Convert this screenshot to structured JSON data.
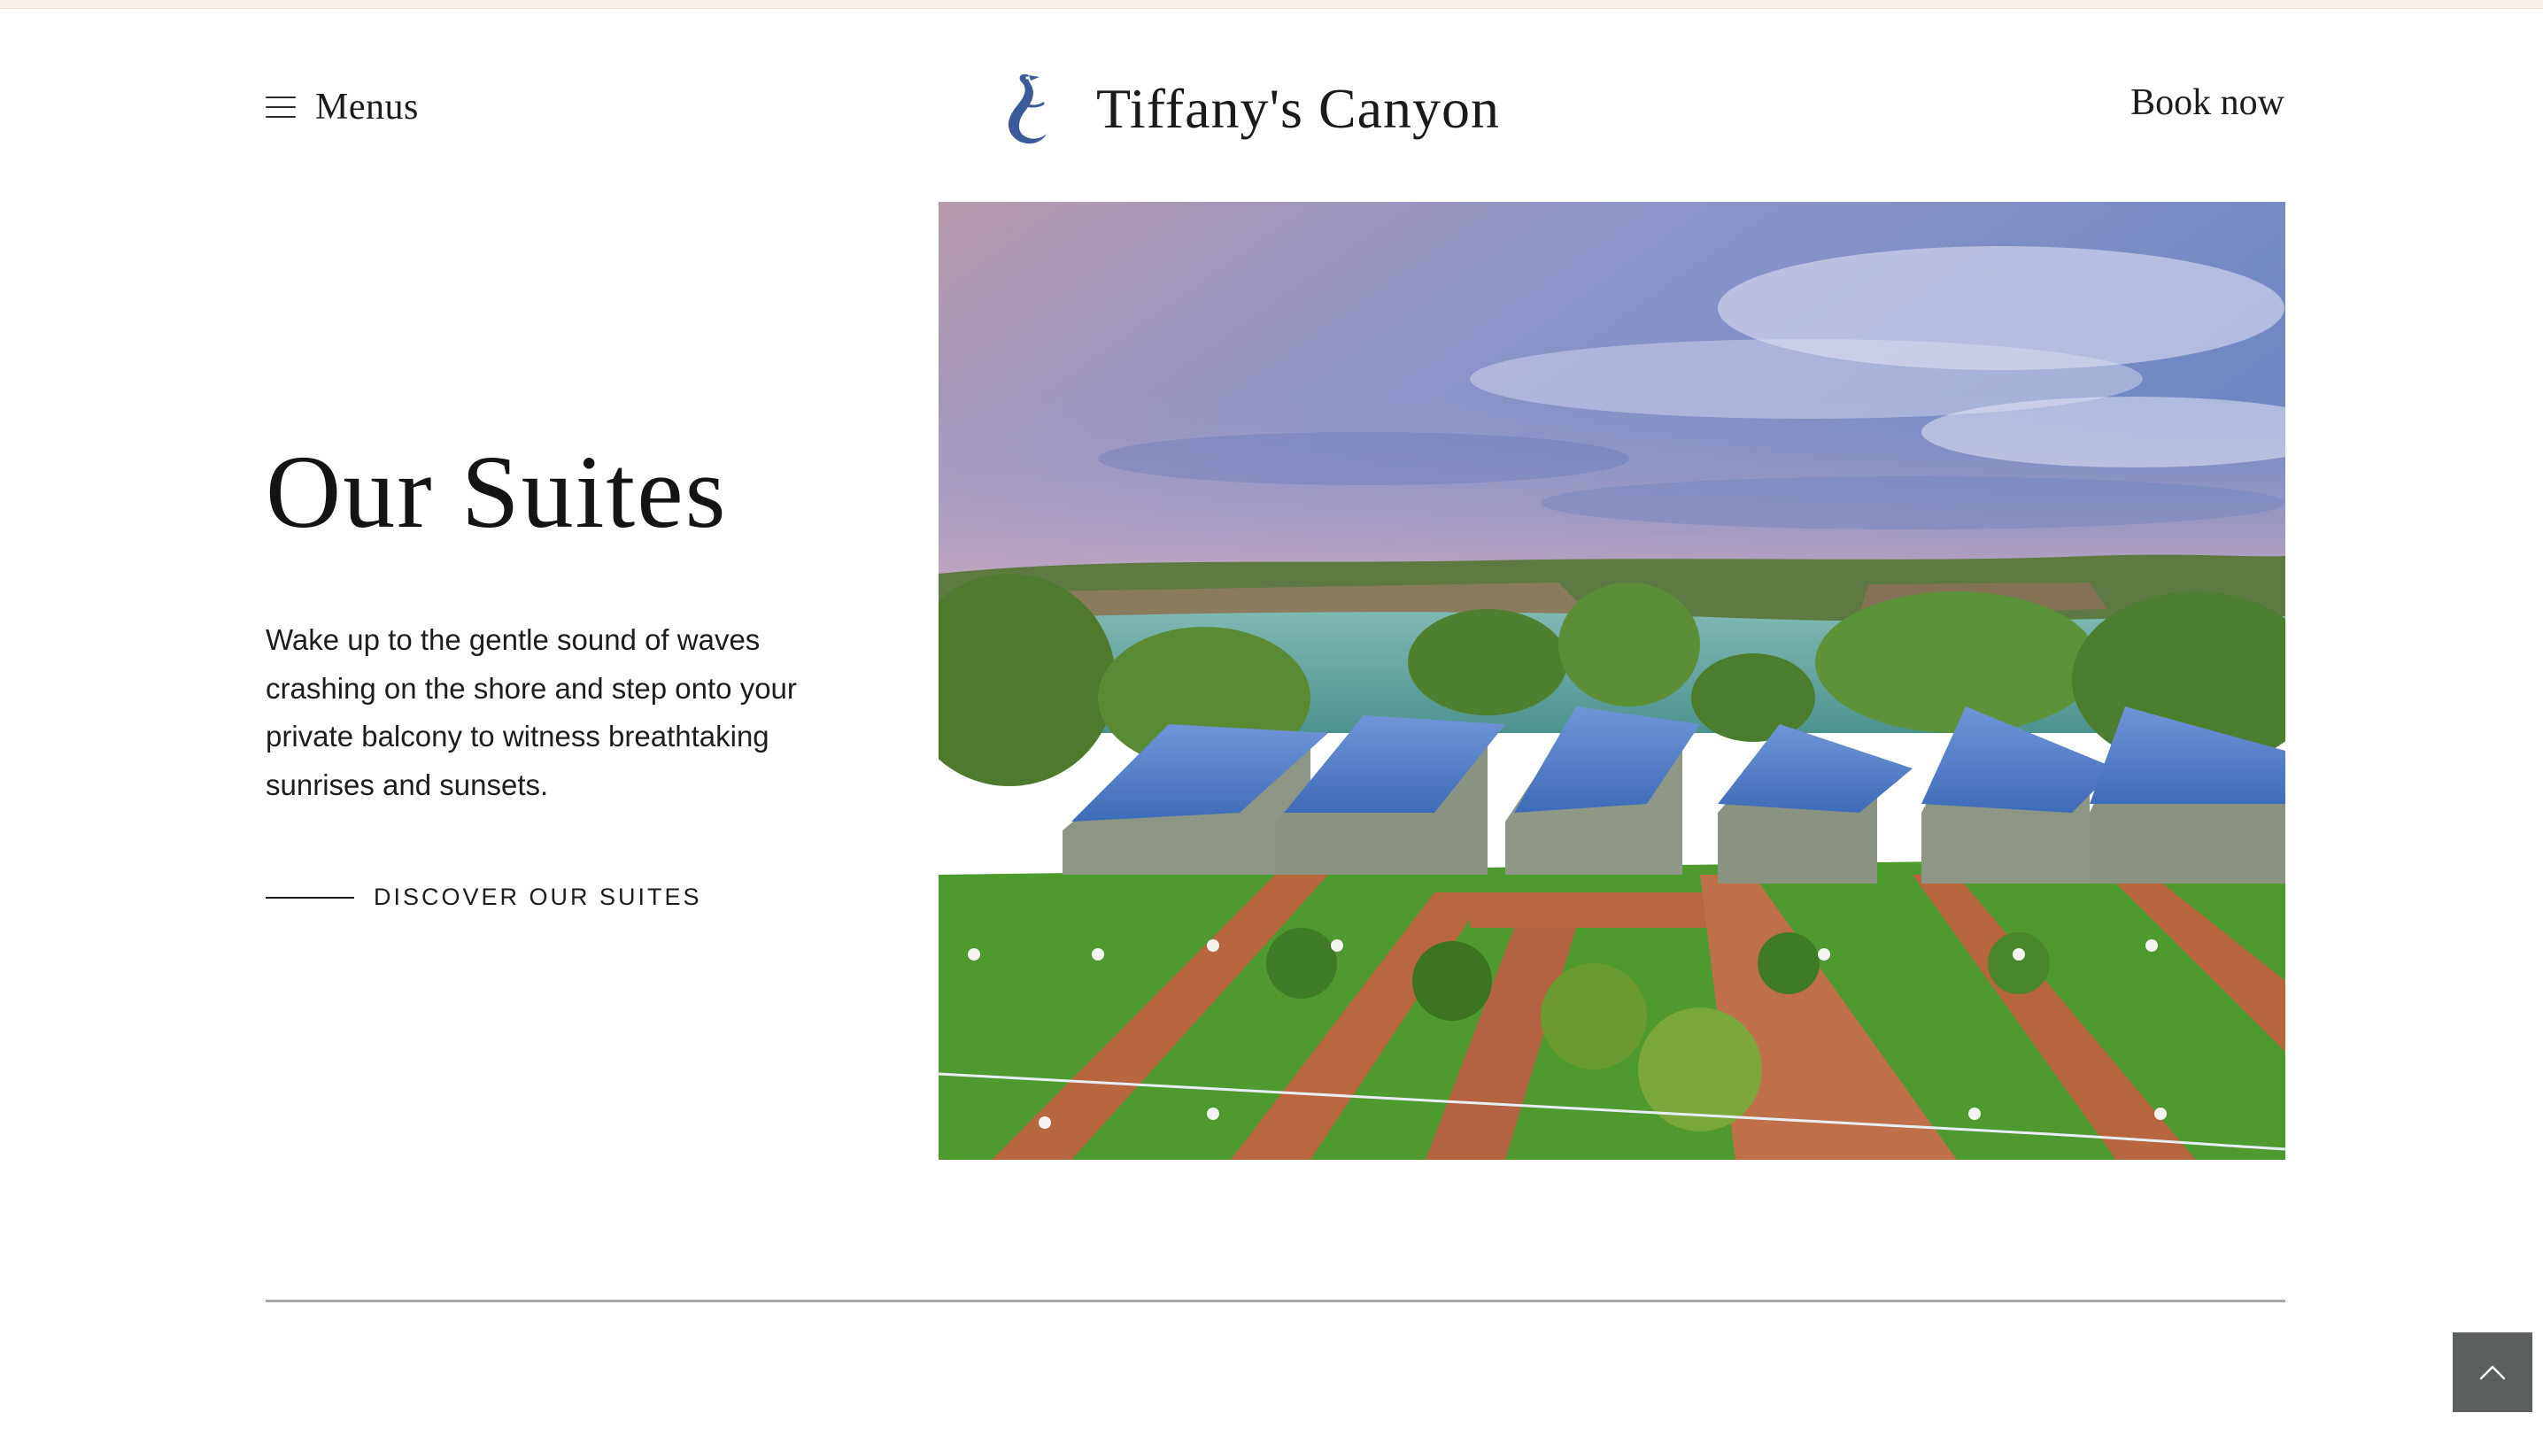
{
  "header": {
    "menu_label": "Menus",
    "brand_name": "Tiffany's Canyon",
    "book_label": "Book now"
  },
  "hero": {
    "title": "Our Suites",
    "description": "Wake up to the gentle sound of waves crashing on the shore and step onto your private balcony to witness breathtaking sunrises and sunsets.",
    "cta_label": "DISCOVER OUR SUITES"
  },
  "icons": {
    "menu": "hamburger-icon",
    "logo": "heron-logo",
    "back_to_top": "chevron-up-icon"
  },
  "colors": {
    "logo_blue": "#3b5a9a",
    "back_to_top_bg": "#5c5f60",
    "divider": "#a6a6a6"
  }
}
